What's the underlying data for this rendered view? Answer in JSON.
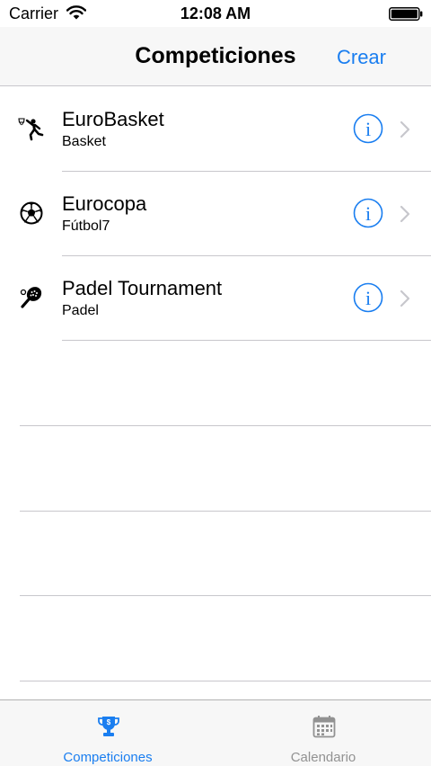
{
  "status_bar": {
    "carrier": "Carrier",
    "time": "12:08 AM"
  },
  "nav": {
    "title": "Competiciones",
    "action_label": "Crear"
  },
  "competitions": [
    {
      "title": "EuroBasket",
      "subtitle": "Basket",
      "icon": "basketball-player-icon"
    },
    {
      "title": "Eurocopa",
      "subtitle": "Fútbol7",
      "icon": "soccer-ball-icon"
    },
    {
      "title": "Padel Tournament",
      "subtitle": "Padel",
      "icon": "padel-racket-icon"
    }
  ],
  "tabs": [
    {
      "label": "Competiciones",
      "icon": "trophy-icon",
      "active": true
    },
    {
      "label": "Calendario",
      "icon": "calendar-icon",
      "active": false
    }
  ],
  "colors": {
    "accent": "#1a7ef0",
    "inactive": "#929292",
    "separator": "#c8c7cc",
    "bar_background": "#f7f7f7"
  }
}
